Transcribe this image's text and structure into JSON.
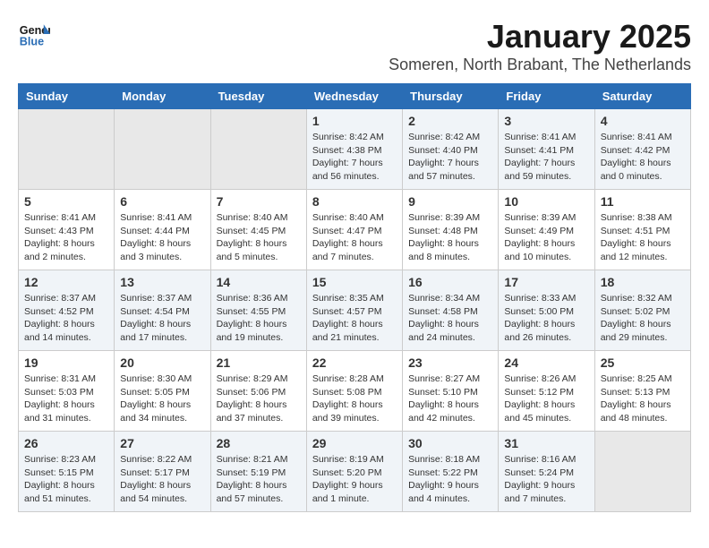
{
  "header": {
    "logo_line1": "General",
    "logo_line2": "Blue",
    "month_year": "January 2025",
    "location": "Someren, North Brabant, The Netherlands"
  },
  "calendar": {
    "days_of_week": [
      "Sunday",
      "Monday",
      "Tuesday",
      "Wednesday",
      "Thursday",
      "Friday",
      "Saturday"
    ],
    "weeks": [
      [
        {
          "day": "",
          "content": ""
        },
        {
          "day": "",
          "content": ""
        },
        {
          "day": "",
          "content": ""
        },
        {
          "day": "1",
          "content": "Sunrise: 8:42 AM\nSunset: 4:38 PM\nDaylight: 7 hours and 56 minutes."
        },
        {
          "day": "2",
          "content": "Sunrise: 8:42 AM\nSunset: 4:40 PM\nDaylight: 7 hours and 57 minutes."
        },
        {
          "day": "3",
          "content": "Sunrise: 8:41 AM\nSunset: 4:41 PM\nDaylight: 7 hours and 59 minutes."
        },
        {
          "day": "4",
          "content": "Sunrise: 8:41 AM\nSunset: 4:42 PM\nDaylight: 8 hours and 0 minutes."
        }
      ],
      [
        {
          "day": "5",
          "content": "Sunrise: 8:41 AM\nSunset: 4:43 PM\nDaylight: 8 hours and 2 minutes."
        },
        {
          "day": "6",
          "content": "Sunrise: 8:41 AM\nSunset: 4:44 PM\nDaylight: 8 hours and 3 minutes."
        },
        {
          "day": "7",
          "content": "Sunrise: 8:40 AM\nSunset: 4:45 PM\nDaylight: 8 hours and 5 minutes."
        },
        {
          "day": "8",
          "content": "Sunrise: 8:40 AM\nSunset: 4:47 PM\nDaylight: 8 hours and 7 minutes."
        },
        {
          "day": "9",
          "content": "Sunrise: 8:39 AM\nSunset: 4:48 PM\nDaylight: 8 hours and 8 minutes."
        },
        {
          "day": "10",
          "content": "Sunrise: 8:39 AM\nSunset: 4:49 PM\nDaylight: 8 hours and 10 minutes."
        },
        {
          "day": "11",
          "content": "Sunrise: 8:38 AM\nSunset: 4:51 PM\nDaylight: 8 hours and 12 minutes."
        }
      ],
      [
        {
          "day": "12",
          "content": "Sunrise: 8:37 AM\nSunset: 4:52 PM\nDaylight: 8 hours and 14 minutes."
        },
        {
          "day": "13",
          "content": "Sunrise: 8:37 AM\nSunset: 4:54 PM\nDaylight: 8 hours and 17 minutes."
        },
        {
          "day": "14",
          "content": "Sunrise: 8:36 AM\nSunset: 4:55 PM\nDaylight: 8 hours and 19 minutes."
        },
        {
          "day": "15",
          "content": "Sunrise: 8:35 AM\nSunset: 4:57 PM\nDaylight: 8 hours and 21 minutes."
        },
        {
          "day": "16",
          "content": "Sunrise: 8:34 AM\nSunset: 4:58 PM\nDaylight: 8 hours and 24 minutes."
        },
        {
          "day": "17",
          "content": "Sunrise: 8:33 AM\nSunset: 5:00 PM\nDaylight: 8 hours and 26 minutes."
        },
        {
          "day": "18",
          "content": "Sunrise: 8:32 AM\nSunset: 5:02 PM\nDaylight: 8 hours and 29 minutes."
        }
      ],
      [
        {
          "day": "19",
          "content": "Sunrise: 8:31 AM\nSunset: 5:03 PM\nDaylight: 8 hours and 31 minutes."
        },
        {
          "day": "20",
          "content": "Sunrise: 8:30 AM\nSunset: 5:05 PM\nDaylight: 8 hours and 34 minutes."
        },
        {
          "day": "21",
          "content": "Sunrise: 8:29 AM\nSunset: 5:06 PM\nDaylight: 8 hours and 37 minutes."
        },
        {
          "day": "22",
          "content": "Sunrise: 8:28 AM\nSunset: 5:08 PM\nDaylight: 8 hours and 39 minutes."
        },
        {
          "day": "23",
          "content": "Sunrise: 8:27 AM\nSunset: 5:10 PM\nDaylight: 8 hours and 42 minutes."
        },
        {
          "day": "24",
          "content": "Sunrise: 8:26 AM\nSunset: 5:12 PM\nDaylight: 8 hours and 45 minutes."
        },
        {
          "day": "25",
          "content": "Sunrise: 8:25 AM\nSunset: 5:13 PM\nDaylight: 8 hours and 48 minutes."
        }
      ],
      [
        {
          "day": "26",
          "content": "Sunrise: 8:23 AM\nSunset: 5:15 PM\nDaylight: 8 hours and 51 minutes."
        },
        {
          "day": "27",
          "content": "Sunrise: 8:22 AM\nSunset: 5:17 PM\nDaylight: 8 hours and 54 minutes."
        },
        {
          "day": "28",
          "content": "Sunrise: 8:21 AM\nSunset: 5:19 PM\nDaylight: 8 hours and 57 minutes."
        },
        {
          "day": "29",
          "content": "Sunrise: 8:19 AM\nSunset: 5:20 PM\nDaylight: 9 hours and 1 minute."
        },
        {
          "day": "30",
          "content": "Sunrise: 8:18 AM\nSunset: 5:22 PM\nDaylight: 9 hours and 4 minutes."
        },
        {
          "day": "31",
          "content": "Sunrise: 8:16 AM\nSunset: 5:24 PM\nDaylight: 9 hours and 7 minutes."
        },
        {
          "day": "",
          "content": ""
        }
      ]
    ]
  }
}
